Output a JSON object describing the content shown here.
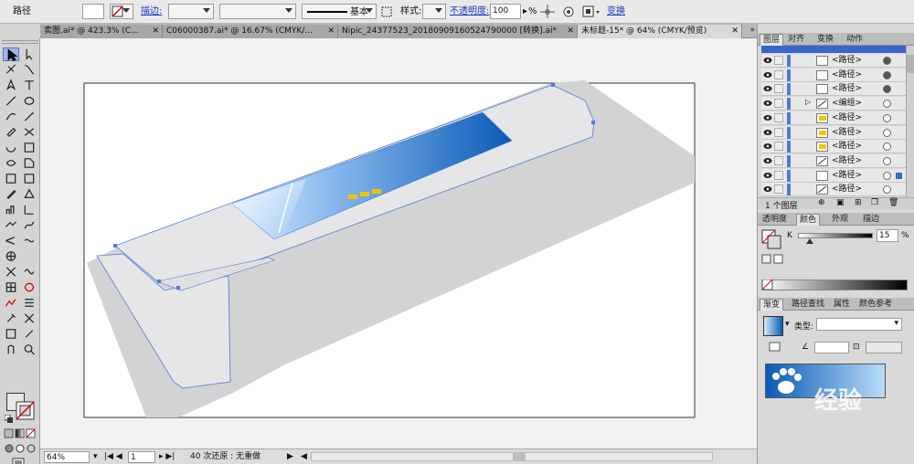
{
  "control_bar": {
    "selection_label": "路径",
    "stroke_label": "描边:",
    "stroke_style_label": "基本",
    "style_label": "样式:",
    "opacity_label": "不透明度:",
    "opacity_value": "100",
    "opacity_unit": "%",
    "transform_label": "变换"
  },
  "doc_tabs": [
    {
      "label": "卖图.ai* @ 423.3% (C...",
      "active": false
    },
    {
      "label": "C06000387.ai* @ 16.67% (CMYK/...",
      "active": false
    },
    {
      "label": "Nipic_24377523_20180909160524790000 [转换].ai*",
      "active": false
    },
    {
      "label": "未标题-15* @ 64% (CMYK/预览)",
      "active": true
    }
  ],
  "status_bar": {
    "zoom": "64%",
    "artboard": "1",
    "undo_text": "40 次还原 : 无重做"
  },
  "layers_panel": {
    "tabs": [
      "图层",
      "对齐",
      "变换",
      "动作"
    ],
    "rows": [
      {
        "name": "<路径>",
        "target_filled": true,
        "thumb": "white",
        "selected": false
      },
      {
        "name": "<路径>",
        "target_filled": true,
        "thumb": "white",
        "selected": false
      },
      {
        "name": "<路径>",
        "target_filled": true,
        "thumb": "white",
        "selected": false
      },
      {
        "name": "<编组>",
        "target_filled": false,
        "thumb": "line",
        "selected": false
      },
      {
        "name": "<路径>",
        "target_filled": false,
        "thumb": "yellow",
        "selected": false
      },
      {
        "name": "<路径>",
        "target_filled": false,
        "thumb": "yellow",
        "selected": false
      },
      {
        "name": "<路径>",
        "target_filled": false,
        "thumb": "yellow",
        "selected": false
      },
      {
        "name": "<路径>",
        "target_filled": false,
        "thumb": "line",
        "selected": false
      },
      {
        "name": "<路径>",
        "target_filled": false,
        "thumb": "white",
        "selected": true
      },
      {
        "name": "<路径>",
        "target_filled": false,
        "thumb": "line",
        "selected": false
      }
    ],
    "footer_count": "1 个图层"
  },
  "color_panel": {
    "tabs": [
      "透明度",
      "颜色",
      "外观",
      "描边"
    ],
    "k_label": "K",
    "k_value": "15",
    "k_unit": "%",
    "k_fraction": 0.15
  },
  "gradient_panel": {
    "tabs": [
      "渐变",
      "路径查找",
      "属性",
      "颜色参考"
    ],
    "type_label": "类型:"
  },
  "watermark": "经验",
  "colors": {
    "panel_bg": "#d9d9d9",
    "canvas_bg": "#f1f1f1",
    "selection_blue": "#4f7ad8",
    "gradient_dark": "#0a5ab6",
    "gradient_light": "#d8ebfb",
    "shadow_gray": "#d3d3d5",
    "button_yellow": "#f5c400"
  }
}
